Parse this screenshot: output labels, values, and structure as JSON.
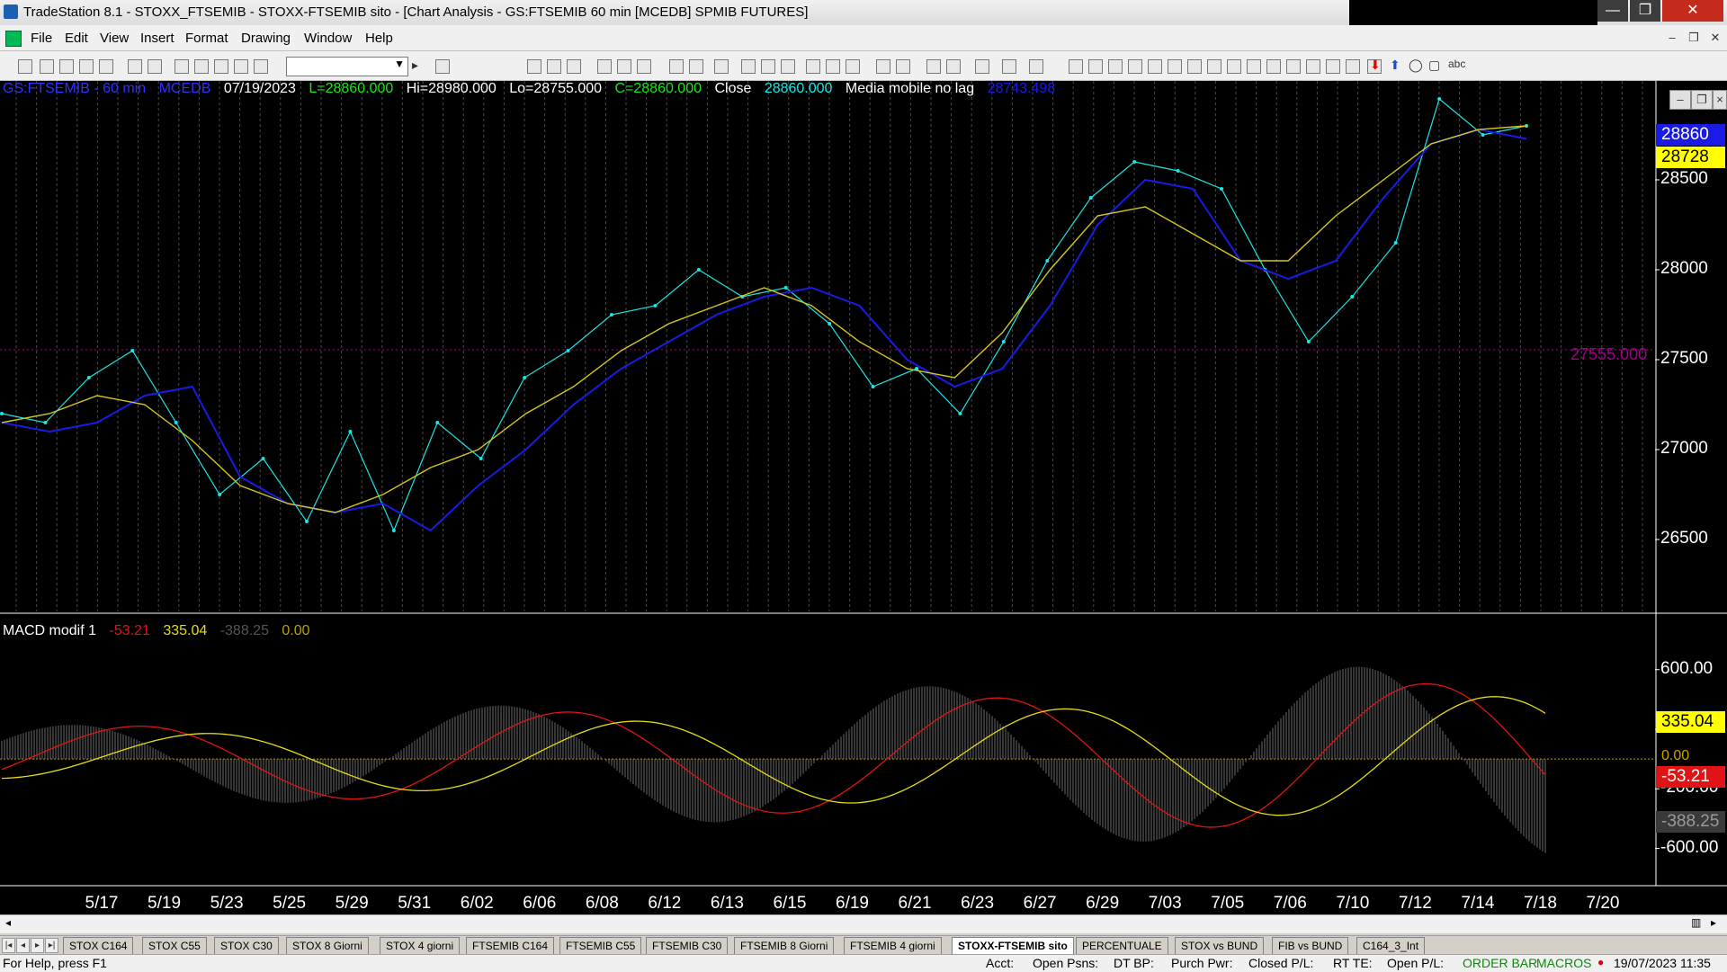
{
  "window": {
    "title": "TradeStation 8.1 - STOXX_FTSEMIB - STOXX-FTSEMIB sito - [Chart Analysis - GS:FTSEMIB  60 min  [MCEDB] SPMIB FUTURES]",
    "minimize": "—",
    "maximize": "❐",
    "close": "✕"
  },
  "menu": [
    "File",
    "Edit",
    "View",
    "Insert",
    "Format",
    "Drawing",
    "Window",
    "Help"
  ],
  "mdi_controls": [
    "–",
    "❐",
    "✕"
  ],
  "toolbar": {
    "abc_label": "abc"
  },
  "chart_header": {
    "symbol": "GS:FTSEMIB - 60 min",
    "exchange": "MCEDB",
    "date": "07/19/2023",
    "low_info": "L=28860.000",
    "hi": "Hi=28980.000",
    "lo": "Lo=28755.000",
    "close_info": "C=28860.000",
    "close_label": "Close",
    "close_value": "28860.000",
    "indicator": "Media mobile no lag",
    "indicator_value": "28743.498"
  },
  "macd_header": {
    "name": "MACD modif 1",
    "v1": "-53.21",
    "v2": "335.04",
    "v3": "-388.25",
    "v4": "0.00"
  },
  "price_tags": {
    "last": "28860",
    "ma": "28728"
  },
  "macd_tags": {
    "yellow": "335.04",
    "red": "-53.21",
    "gray": "-388.25",
    "zero": "0.00"
  },
  "ref_line_label": "27555.000",
  "colors": {
    "price": "#19e6e6",
    "ma_blue": "#1a1ae6",
    "ma_yellow": "#d4c81a",
    "macd_red": "#e01414",
    "macd_yellow": "#e6dc14",
    "hist": "#888888",
    "ref": "#a0008a"
  },
  "chart_data": [
    {
      "type": "line",
      "x": [
        "5/17",
        "5/19",
        "5/23",
        "5/25",
        "5/29",
        "5/31",
        "6/02",
        "6/06",
        "6/08",
        "6/12",
        "6/13",
        "6/15",
        "6/19",
        "6/21",
        "6/23",
        "6/27",
        "6/29",
        "7/03",
        "7/05",
        "7/06",
        "7/10",
        "7/12",
        "7/14",
        "7/18",
        "7/20"
      ],
      "y_ticks": [
        26500,
        27000,
        27500,
        28000,
        28500
      ],
      "ylim": [
        26100,
        29050
      ],
      "series": [
        {
          "values": [
            27200,
            27150,
            27400,
            27550,
            27150,
            26750,
            26950,
            26600,
            27100,
            26550,
            27150,
            26950,
            27400,
            27550,
            27750,
            27800,
            28000,
            27850,
            27900,
            27700,
            27350,
            27450,
            27200,
            27600,
            28050,
            28400,
            28600,
            28550,
            28450,
            28000,
            27600,
            27850,
            28150,
            28950,
            28750,
            28800
          ]
        },
        {
          "values": [
            27150,
            27100,
            27150,
            27300,
            27350,
            26850,
            26700,
            26650,
            26700,
            26550,
            26800,
            27000,
            27250,
            27450,
            27600,
            27750,
            27850,
            27900,
            27800,
            27500,
            27350,
            27450,
            27800,
            28250,
            28500,
            28450,
            28050,
            27950,
            28050,
            28400,
            28700,
            28780,
            28728
          ]
        },
        {
          "values": [
            27150,
            27200,
            27300,
            27250,
            27050,
            26800,
            26700,
            26650,
            26750,
            26900,
            27000,
            27200,
            27350,
            27550,
            27700,
            27800,
            27900,
            27800,
            27600,
            27450,
            27400,
            27650,
            28000,
            28300,
            28350,
            28200,
            28050,
            28050,
            28300,
            28500,
            28700,
            28780,
            28800
          ]
        }
      ],
      "ref_line": 27555
    },
    {
      "type": "line",
      "ylim": [
        -850,
        900
      ],
      "y_ticks": [
        600,
        200,
        -200,
        -600
      ],
      "zero_line": 0
    }
  ],
  "tabs": [
    "STOX C164",
    "STOX C55",
    "STOX  C30",
    "STOX  8 Giorni",
    "STOX 4 giorni",
    "FTSEMIB C164",
    "FTSEMIB C55",
    "FTSEMIB C30",
    "FTSEMIB  8 Giorni",
    "FTSEMIB  4 giorni",
    "STOXX-FTSEMIB sito",
    "PERCENTUALE",
    "STOX vs BUND",
    "FIB vs BUND",
    "C164_3_Int"
  ],
  "active_tab": "STOXX-FTSEMIB sito",
  "status": {
    "help": "For Help, press F1",
    "acct": "Acct:",
    "open_psns": "Open Psns:",
    "dt_bp": "DT BP:",
    "purch_pwr": "Purch Pwr:",
    "closed_pl": "Closed P/L:",
    "rt_te": "RT TE:",
    "open_pl": "Open P/L:",
    "order_bar": "ORDER BAR",
    "macros": "MACROS",
    "datetime": "19/07/2023 11:35"
  }
}
